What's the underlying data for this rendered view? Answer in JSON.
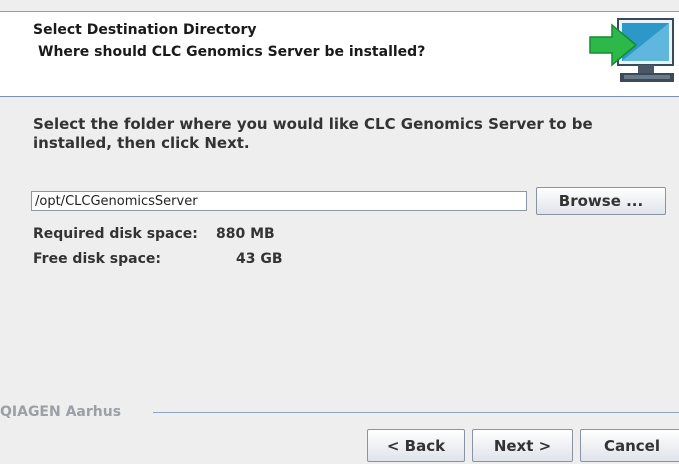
{
  "header": {
    "title": "Select Destination Directory",
    "subtitle": "Where should CLC Genomics Server be installed?",
    "icon": "install-monitor-icon",
    "colors": {
      "arrow": "#2db84a",
      "screen": "#2c98c8"
    }
  },
  "main": {
    "instruction": "Select the folder where you would like CLC Genomics Server to be installed, then click Next.",
    "path_value": "/opt/CLCGenomicsServer",
    "browse_label": "Browse ...",
    "required_label": "Required disk space:",
    "required_value": "880 MB",
    "free_label": "Free disk space:",
    "free_value": "43 GB"
  },
  "footer": {
    "company": "QIAGEN Aarhus",
    "back_label": "< Back",
    "next_label": "Next >",
    "cancel_label": "Cancel"
  }
}
